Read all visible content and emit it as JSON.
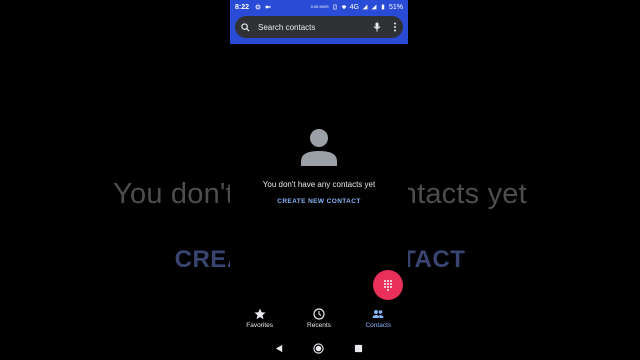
{
  "background": {
    "line1": "You don't have any contacts yet",
    "line2": "CREATE NEW CONTACT"
  },
  "status": {
    "time": "8:22",
    "network": "4G",
    "battery": "51%",
    "data_rate": "0.00 KB/S"
  },
  "search": {
    "placeholder": "Search contacts"
  },
  "empty_state": {
    "message": "You don't have any contacts yet",
    "action": "CREATE NEW CONTACT"
  },
  "bottom_nav": {
    "items": [
      {
        "label": "Favorites",
        "icon": "star-icon"
      },
      {
        "label": "Recents",
        "icon": "clock-icon"
      },
      {
        "label": "Contacts",
        "icon": "people-icon",
        "active": true
      }
    ]
  },
  "colors": {
    "status_bar": "#2a4bd6",
    "accent": "#8ab4f8",
    "fab": "#e8305a"
  }
}
